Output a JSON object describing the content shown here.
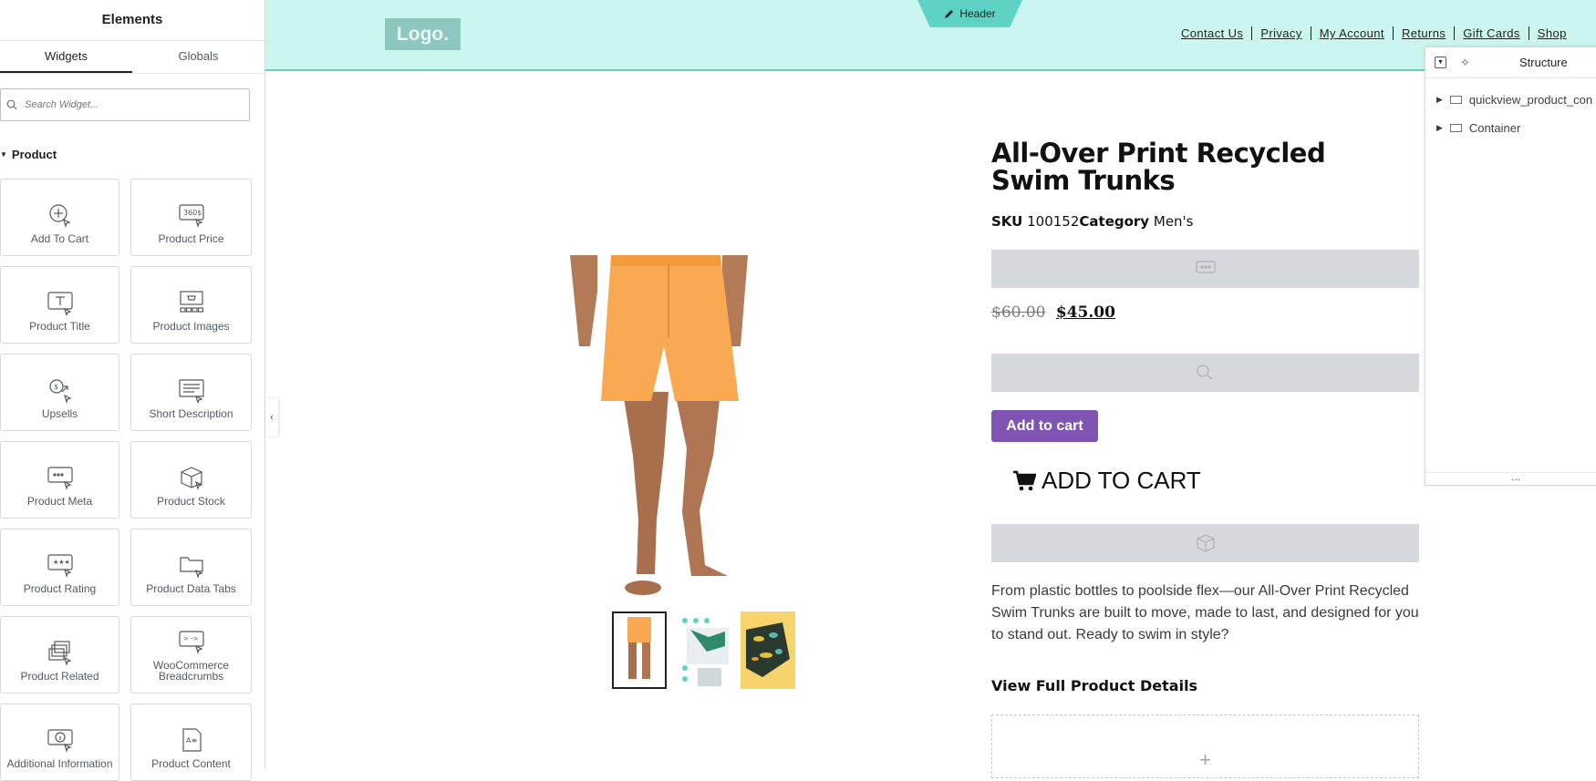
{
  "panel": {
    "title": "Elements",
    "tabs": [
      "Widgets",
      "Globals"
    ],
    "search_placeholder": "Search Widget...",
    "category": "Product",
    "widgets": [
      {
        "label": "Add To Cart",
        "icon": "add-to-cart-icon"
      },
      {
        "label": "Product Price",
        "icon": "product-price-icon"
      },
      {
        "label": "Product Title",
        "icon": "product-title-icon"
      },
      {
        "label": "Product Images",
        "icon": "product-images-icon"
      },
      {
        "label": "Upsells",
        "icon": "upsells-icon"
      },
      {
        "label": "Short Description",
        "icon": "short-description-icon"
      },
      {
        "label": "Product Meta",
        "icon": "product-meta-icon"
      },
      {
        "label": "Product Stock",
        "icon": "product-stock-icon"
      },
      {
        "label": "Product Rating",
        "icon": "product-rating-icon"
      },
      {
        "label": "Product Data Tabs",
        "icon": "product-data-tabs-icon"
      },
      {
        "label": "Product Related",
        "icon": "product-related-icon"
      },
      {
        "label": "WooCommerce Breadcrumbs",
        "icon": "breadcrumbs-icon"
      },
      {
        "label": "Additional Information",
        "icon": "additional-information-icon"
      },
      {
        "label": "Product Content",
        "icon": "product-content-icon"
      }
    ]
  },
  "header": {
    "logo": "Logo.",
    "tab_label": "Header",
    "nav": [
      "Contact Us",
      "Privacy",
      "My Account",
      "Returns",
      "Gift Cards",
      "Shop"
    ]
  },
  "product": {
    "title": "All-Over Print Recycled Swim Trunks",
    "sku_label": "SKU",
    "sku": "100152",
    "category_label": "Category",
    "category": "Men's",
    "price_old": "$60.00",
    "price_new": "$45.00",
    "add_to_cart": "Add to cart",
    "add_to_cart_big": "ADD TO CART",
    "description": "From plastic bottles to poolside flex—our All-Over Print Recycled Swim Trunks are built to move, made to last, and designed for you to stand out. Ready to swim in style?",
    "details_link": "View Full Product Details",
    "dropzone_plus": "+"
  },
  "structure": {
    "title": "Structure",
    "items": [
      "quickview_product_con",
      "Container"
    ],
    "dots": "..."
  },
  "colors": {
    "header_bg": "#cbf5ef",
    "header_accent": "#5fd3c3",
    "button_purple": "#7f54b3",
    "swim_orange": "#f8a951"
  }
}
